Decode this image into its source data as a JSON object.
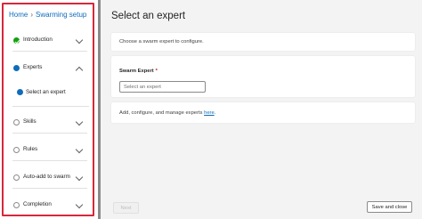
{
  "breadcrumb": {
    "home": "Home",
    "current": "Swarming setup"
  },
  "steps": [
    {
      "label": "Introduction",
      "state": "done"
    },
    {
      "label": "Experts",
      "state": "active",
      "substeps": [
        {
          "label": "Select an expert"
        }
      ]
    },
    {
      "label": "Skills",
      "state": "pending"
    },
    {
      "label": "Rules",
      "state": "pending"
    },
    {
      "label": "Auto-add to swarm",
      "state": "pending"
    },
    {
      "label": "Completion",
      "state": "pending"
    }
  ],
  "main": {
    "title": "Select an expert",
    "intro": "Choose a swarm expert to configure.",
    "field": {
      "label": "Swarm Expert",
      "required_mark": "*",
      "placeholder": "Select an expert"
    },
    "manage": {
      "text": "Add, configure, and manage experts",
      "link_label": "here",
      "suffix": "."
    }
  },
  "footer": {
    "next_label": "Next",
    "save_close_label": "Save and close"
  },
  "colors": {
    "accent": "#0f6cbd",
    "done": "#13a10e",
    "highlight_border": "#d6283b"
  }
}
